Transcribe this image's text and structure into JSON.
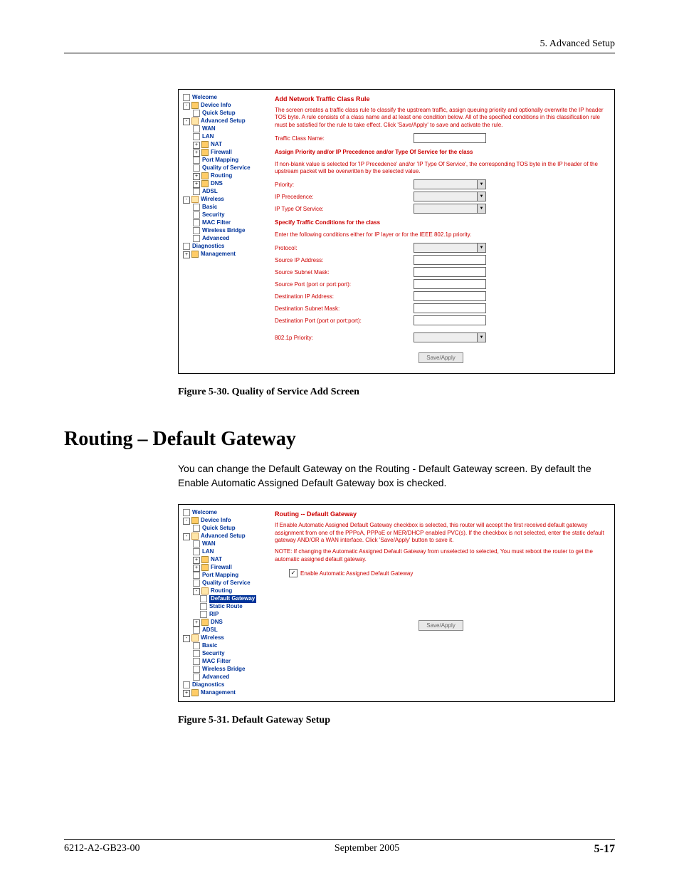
{
  "header": {
    "chapter": "5. Advanced Setup"
  },
  "shot1": {
    "nav": [
      {
        "lvl": 1,
        "kind": "pg",
        "label": "Welcome"
      },
      {
        "lvl": 1,
        "kind": "fld",
        "exp": "-",
        "label": "Device Info"
      },
      {
        "lvl": 2,
        "kind": "pg",
        "label": "Quick Setup"
      },
      {
        "lvl": 1,
        "kind": "fldo",
        "exp": "-",
        "label": "Advanced Setup"
      },
      {
        "lvl": 2,
        "kind": "pg",
        "label": "WAN"
      },
      {
        "lvl": 2,
        "kind": "pg",
        "label": "LAN"
      },
      {
        "lvl": 2,
        "kind": "fld",
        "exp": "+",
        "label": "NAT"
      },
      {
        "lvl": 2,
        "kind": "fld",
        "exp": "+",
        "label": "Firewall"
      },
      {
        "lvl": 2,
        "kind": "pg",
        "label": "Port Mapping"
      },
      {
        "lvl": 2,
        "kind": "pg",
        "label": "Quality of Service"
      },
      {
        "lvl": 2,
        "kind": "fld",
        "exp": "+",
        "label": "Routing"
      },
      {
        "lvl": 2,
        "kind": "fld",
        "exp": "+",
        "label": "DNS"
      },
      {
        "lvl": 2,
        "kind": "pg",
        "label": "ADSL"
      },
      {
        "lvl": 1,
        "kind": "fldo",
        "exp": "-",
        "label": "Wireless"
      },
      {
        "lvl": 2,
        "kind": "pg",
        "label": "Basic"
      },
      {
        "lvl": 2,
        "kind": "pg",
        "label": "Security"
      },
      {
        "lvl": 2,
        "kind": "pg",
        "label": "MAC Filter"
      },
      {
        "lvl": 2,
        "kind": "pg",
        "label": "Wireless Bridge"
      },
      {
        "lvl": 2,
        "kind": "pg",
        "label": "Advanced"
      },
      {
        "lvl": 1,
        "kind": "pg",
        "label": "Diagnostics"
      },
      {
        "lvl": 1,
        "kind": "fld",
        "exp": "+",
        "label": "Management"
      }
    ],
    "title": "Add Network Traffic Class Rule",
    "intro": "The screen creates a traffic class rule to classify the upstream traffic, assign queuing priority and optionally overwrite the IP header TOS byte. A rule consists of a class name and at least one condition below. All of the specified conditions in this classification rule must be satisfied for the rule to take effect. Click 'Save/Apply' to save and activate the rule.",
    "class_name_label": "Traffic Class Name:",
    "assign_title": "Assign Priority and/or IP Precedence and/or Type Of Service for the class",
    "assign_desc": "If non-blank value is selected for 'IP Precedence' and/or 'IP Type Of Service', the corresponding TOS byte in the IP header of the upstream packet will be overwritten by the selected value.",
    "priority_label": "Priority:",
    "precedence_label": "IP Precedence:",
    "tos_label": "IP Type Of Service:",
    "cond_title": "Specify Traffic Conditions for the class",
    "cond_desc": "Enter the following conditions either for IP layer or for the IEEE 802.1p priority.",
    "protocol_label": "Protocol:",
    "src_ip_label": "Source IP Address:",
    "src_mask_label": "Source Subnet Mask:",
    "src_port_label": "Source Port (port or port:port):",
    "dst_ip_label": "Destination IP Address:",
    "dst_mask_label": "Destination Subnet Mask:",
    "dst_port_label": "Destination Port (port or port:port):",
    "dot1p_label": "802.1p Priority:",
    "save_btn": "Save/Apply"
  },
  "caption1": "Figure 5-30.   Quality of Service Add Screen",
  "h2": "Routing – Default Gateway",
  "para": "You can change the Default Gateway on the Routing - Default Gateway screen. By default the Enable Automatic Assigned Default Gateway box is checked.",
  "shot2": {
    "nav": [
      {
        "lvl": 1,
        "kind": "pg",
        "label": "Welcome"
      },
      {
        "lvl": 1,
        "kind": "fld",
        "exp": "-",
        "label": "Device Info"
      },
      {
        "lvl": 2,
        "kind": "pg",
        "label": "Quick Setup"
      },
      {
        "lvl": 1,
        "kind": "fldo",
        "exp": "-",
        "label": "Advanced Setup"
      },
      {
        "lvl": 2,
        "kind": "pg",
        "label": "WAN"
      },
      {
        "lvl": 2,
        "kind": "pg",
        "label": "LAN"
      },
      {
        "lvl": 2,
        "kind": "fld",
        "exp": "+",
        "label": "NAT"
      },
      {
        "lvl": 2,
        "kind": "fld",
        "exp": "+",
        "label": "Firewall"
      },
      {
        "lvl": 2,
        "kind": "pg",
        "label": "Port Mapping"
      },
      {
        "lvl": 2,
        "kind": "pg",
        "label": "Quality of Service"
      },
      {
        "lvl": 2,
        "kind": "fldo",
        "exp": "-",
        "label": "Routing"
      },
      {
        "lvl": 3,
        "kind": "pg",
        "sel": true,
        "label": "Default Gateway"
      },
      {
        "lvl": 3,
        "kind": "pg",
        "label": "Static Route"
      },
      {
        "lvl": 3,
        "kind": "pg",
        "label": "RIP"
      },
      {
        "lvl": 2,
        "kind": "fld",
        "exp": "+",
        "label": "DNS"
      },
      {
        "lvl": 2,
        "kind": "pg",
        "label": "ADSL"
      },
      {
        "lvl": 1,
        "kind": "fldo",
        "exp": "-",
        "label": "Wireless"
      },
      {
        "lvl": 2,
        "kind": "pg",
        "label": "Basic"
      },
      {
        "lvl": 2,
        "kind": "pg",
        "label": "Security"
      },
      {
        "lvl": 2,
        "kind": "pg",
        "label": "MAC Filter"
      },
      {
        "lvl": 2,
        "kind": "pg",
        "label": "Wireless Bridge"
      },
      {
        "lvl": 2,
        "kind": "pg",
        "label": "Advanced"
      },
      {
        "lvl": 1,
        "kind": "pg",
        "label": "Diagnostics"
      },
      {
        "lvl": 1,
        "kind": "fld",
        "exp": "+",
        "label": "Management"
      }
    ],
    "title": "Routing -- Default Gateway",
    "desc": "If Enable Automatic Assigned Default Gateway checkbox is selected, this router will accept the first received default gateway assignment from one of the PPPoA, PPPoE or MER/DHCP enabled PVC(s). If the checkbox is not selected, enter the static default gateway AND/OR a WAN interface. Click 'Save/Apply' button to save it.",
    "note": "NOTE: If changing the Automatic Assigned Default Gateway from unselected to selected, You must reboot the router to get the automatic assigned default gateway.",
    "chk_label": "Enable Automatic Assigned Default Gateway",
    "save_btn": "Save/Apply"
  },
  "caption2": "Figure 5-31.   Default Gateway Setup",
  "footer": {
    "left": "6212-A2-GB23-00",
    "center": "September 2005",
    "right": "5-17"
  }
}
